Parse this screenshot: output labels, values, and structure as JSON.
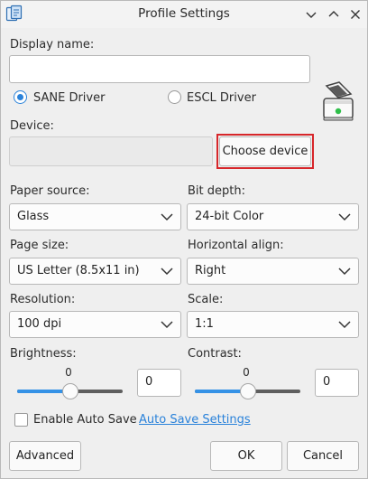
{
  "window": {
    "title": "Profile Settings"
  },
  "form": {
    "display_name_label": "Display name:",
    "display_name_value": "",
    "driver_options": [
      {
        "label": "SANE Driver",
        "checked": true
      },
      {
        "label": "ESCL Driver",
        "checked": false
      }
    ],
    "device_label": "Device:",
    "device_value": "",
    "choose_device_label": "Choose device",
    "paper_source": {
      "label": "Paper source:",
      "value": "Glass"
    },
    "bit_depth": {
      "label": "Bit depth:",
      "value": "24-bit Color"
    },
    "page_size": {
      "label": "Page size:",
      "value": "US Letter (8.5x11 in)"
    },
    "horizontal_align": {
      "label": "Horizontal align:",
      "value": "Right"
    },
    "resolution": {
      "label": "Resolution:",
      "value": "100 dpi"
    },
    "scale": {
      "label": "Scale:",
      "value": "1:1"
    },
    "brightness": {
      "label": "Brightness:",
      "slider_value": "0",
      "spin_value": "0",
      "fraction": 0.5
    },
    "contrast": {
      "label": "Contrast:",
      "slider_value": "0",
      "spin_value": "0",
      "fraction": 0.5
    },
    "auto_save": {
      "label": "Enable Auto Save",
      "checked": false
    },
    "auto_save_settings_label": "Auto Save Settings"
  },
  "buttons": {
    "advanced": "Advanced",
    "ok": "OK",
    "cancel": "Cancel"
  },
  "icons": {
    "app": "scanner-app-icon",
    "scanner": "scanner-icon",
    "collapse": "chevron-down-icon",
    "maximize": "chevron-up-icon",
    "close": "close-icon"
  },
  "colors": {
    "accent": "#2a82da",
    "highlight": "#d7262a",
    "slider_fill": "#3592e6"
  }
}
